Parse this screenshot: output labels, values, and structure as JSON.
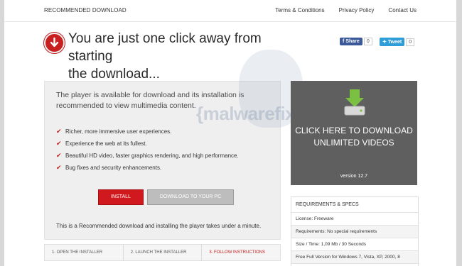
{
  "header": {
    "brand": "RECOMMENDED DOWNLOAD",
    "links": [
      "Terms & Conditions",
      "Privacy Policy",
      "Contact Us"
    ]
  },
  "headline": {
    "line1": "You are just one click away from starting",
    "line2": "the download..."
  },
  "social": {
    "facebook_label": "Share",
    "facebook_count": "0",
    "twitter_label": "Tweet",
    "twitter_count": "0"
  },
  "watermark": "{malwarefixes",
  "panel": {
    "intro": "The player is available for download and its installation is recommended to view multimedia content.",
    "features": [
      "Richer, more immersive user experiences.",
      "Experience the web at its fullest.",
      "Beautiful HD video, faster graphics rendering, and high performance.",
      "Bug fixes and security enhancements."
    ],
    "install_label": "INSTALL",
    "download_label": "DOWNLOAD TO YOUR PC",
    "note": "This is a Recommended download and installing the player takes under a minute."
  },
  "steps": [
    "1. OPEN THE INSTALLER",
    "2. LAUNCH THE INSTALLER",
    "3. FOLLOW INSTRUCTIONS"
  ],
  "promo": {
    "title_line1": "CLICK HERE TO DOWNLOAD",
    "title_line2": "UNLIMITED VIDEOS",
    "version": "version 12.7"
  },
  "requirements": {
    "title": "REQUIREMENTS & SPECS",
    "rows": [
      "License: Freeware",
      "Requirements: No special requirements",
      "Size / Time: 1,09 Mb / 30 Seconds",
      "Free Full Version for Windows 7, Vista, XP, 2000, 8"
    ]
  },
  "colors": {
    "accent_red": "#d0181f",
    "promo_bg": "#5f5f5f",
    "facebook": "#3b5998",
    "twitter": "#2f9ed8"
  }
}
